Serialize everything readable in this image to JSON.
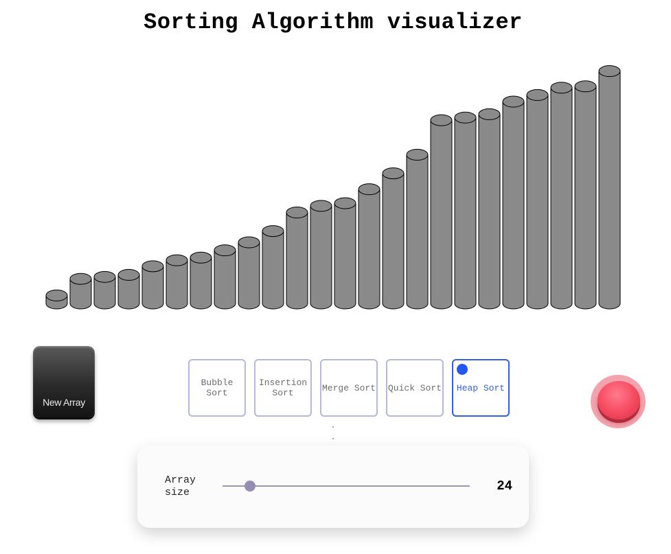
{
  "title": "Sorting Algorithm visualizer",
  "chart_data": {
    "type": "bar",
    "values": [
      12,
      37,
      40,
      43,
      56,
      65,
      69,
      80,
      92,
      109,
      137,
      147,
      151,
      172,
      196,
      224,
      276,
      280,
      285,
      304,
      314,
      325,
      327,
      350
    ]
  },
  "colors": {
    "bar_fill": "#8a8a8a",
    "selected_accent": "#2f5fe6",
    "start_button": "#f5495f"
  },
  "controls": {
    "new_array_label": "New Array",
    "start_button_icon": "round-red-button"
  },
  "algorithms": [
    {
      "label": "Bubble Sort",
      "selected": false
    },
    {
      "label": "Insertion Sort",
      "selected": false
    },
    {
      "label": "Merge Sort",
      "selected": false
    },
    {
      "label": "Quick Sort",
      "selected": false
    },
    {
      "label": "Heap Sort",
      "selected": true
    }
  ],
  "array_size": {
    "label": "Array size",
    "value": "24",
    "slider_fraction": 0.11
  }
}
